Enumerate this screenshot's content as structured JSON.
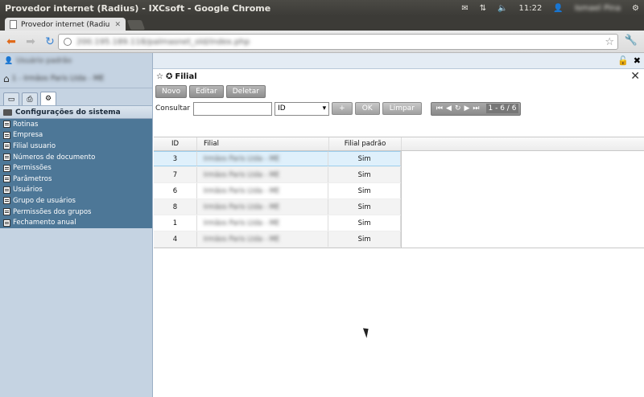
{
  "os": {
    "window_title": "Provedor internet (Radius) - IXCsoft - Google Chrome",
    "time": "11:22",
    "user": "Ismael Pina"
  },
  "browser": {
    "tab_label": "Provedor internet (Radiu",
    "url": "200.195.189.118/palmasnet_old/index.php"
  },
  "sidebar": {
    "user": "Usuário padrão",
    "company": "1 - Irmãos Paris Ltda - ME",
    "section_title": "Configurações do sistema",
    "items": [
      "Rotinas",
      "Empresa",
      "Filial usuario",
      "Números de documento",
      "Permissões",
      "Parâmetros",
      "Usuários",
      "Grupo de usuários",
      "Permissões dos grupos",
      "Fechamento anual"
    ]
  },
  "panel": {
    "title": "Filial",
    "buttons": {
      "new": "Novo",
      "edit": "Editar",
      "delete": "Deletar"
    },
    "search": {
      "label": "Consultar",
      "field": "ID",
      "plus": "+",
      "ok": "OK",
      "clear": "Limpar",
      "page_info": "1 - 6 / 6"
    }
  },
  "grid": {
    "headers": {
      "id": "ID",
      "filial": "Filial",
      "padrao": "Filial padrão"
    },
    "rows": [
      {
        "id": "3",
        "filial": "Irmãos Paris Ltda - ME",
        "padrao": "Sim"
      },
      {
        "id": "7",
        "filial": "Irmãos Paris Ltda - ME",
        "padrao": "Sim"
      },
      {
        "id": "6",
        "filial": "Irmãos Paris Ltda - ME",
        "padrao": "Sim"
      },
      {
        "id": "8",
        "filial": "Irmãos Paris Ltda - ME",
        "padrao": "Sim"
      },
      {
        "id": "1",
        "filial": "Irmãos Paris Ltda - ME",
        "padrao": "Sim"
      },
      {
        "id": "4",
        "filial": "Irmãos Paris Ltda - ME",
        "padrao": "Sim"
      }
    ]
  }
}
